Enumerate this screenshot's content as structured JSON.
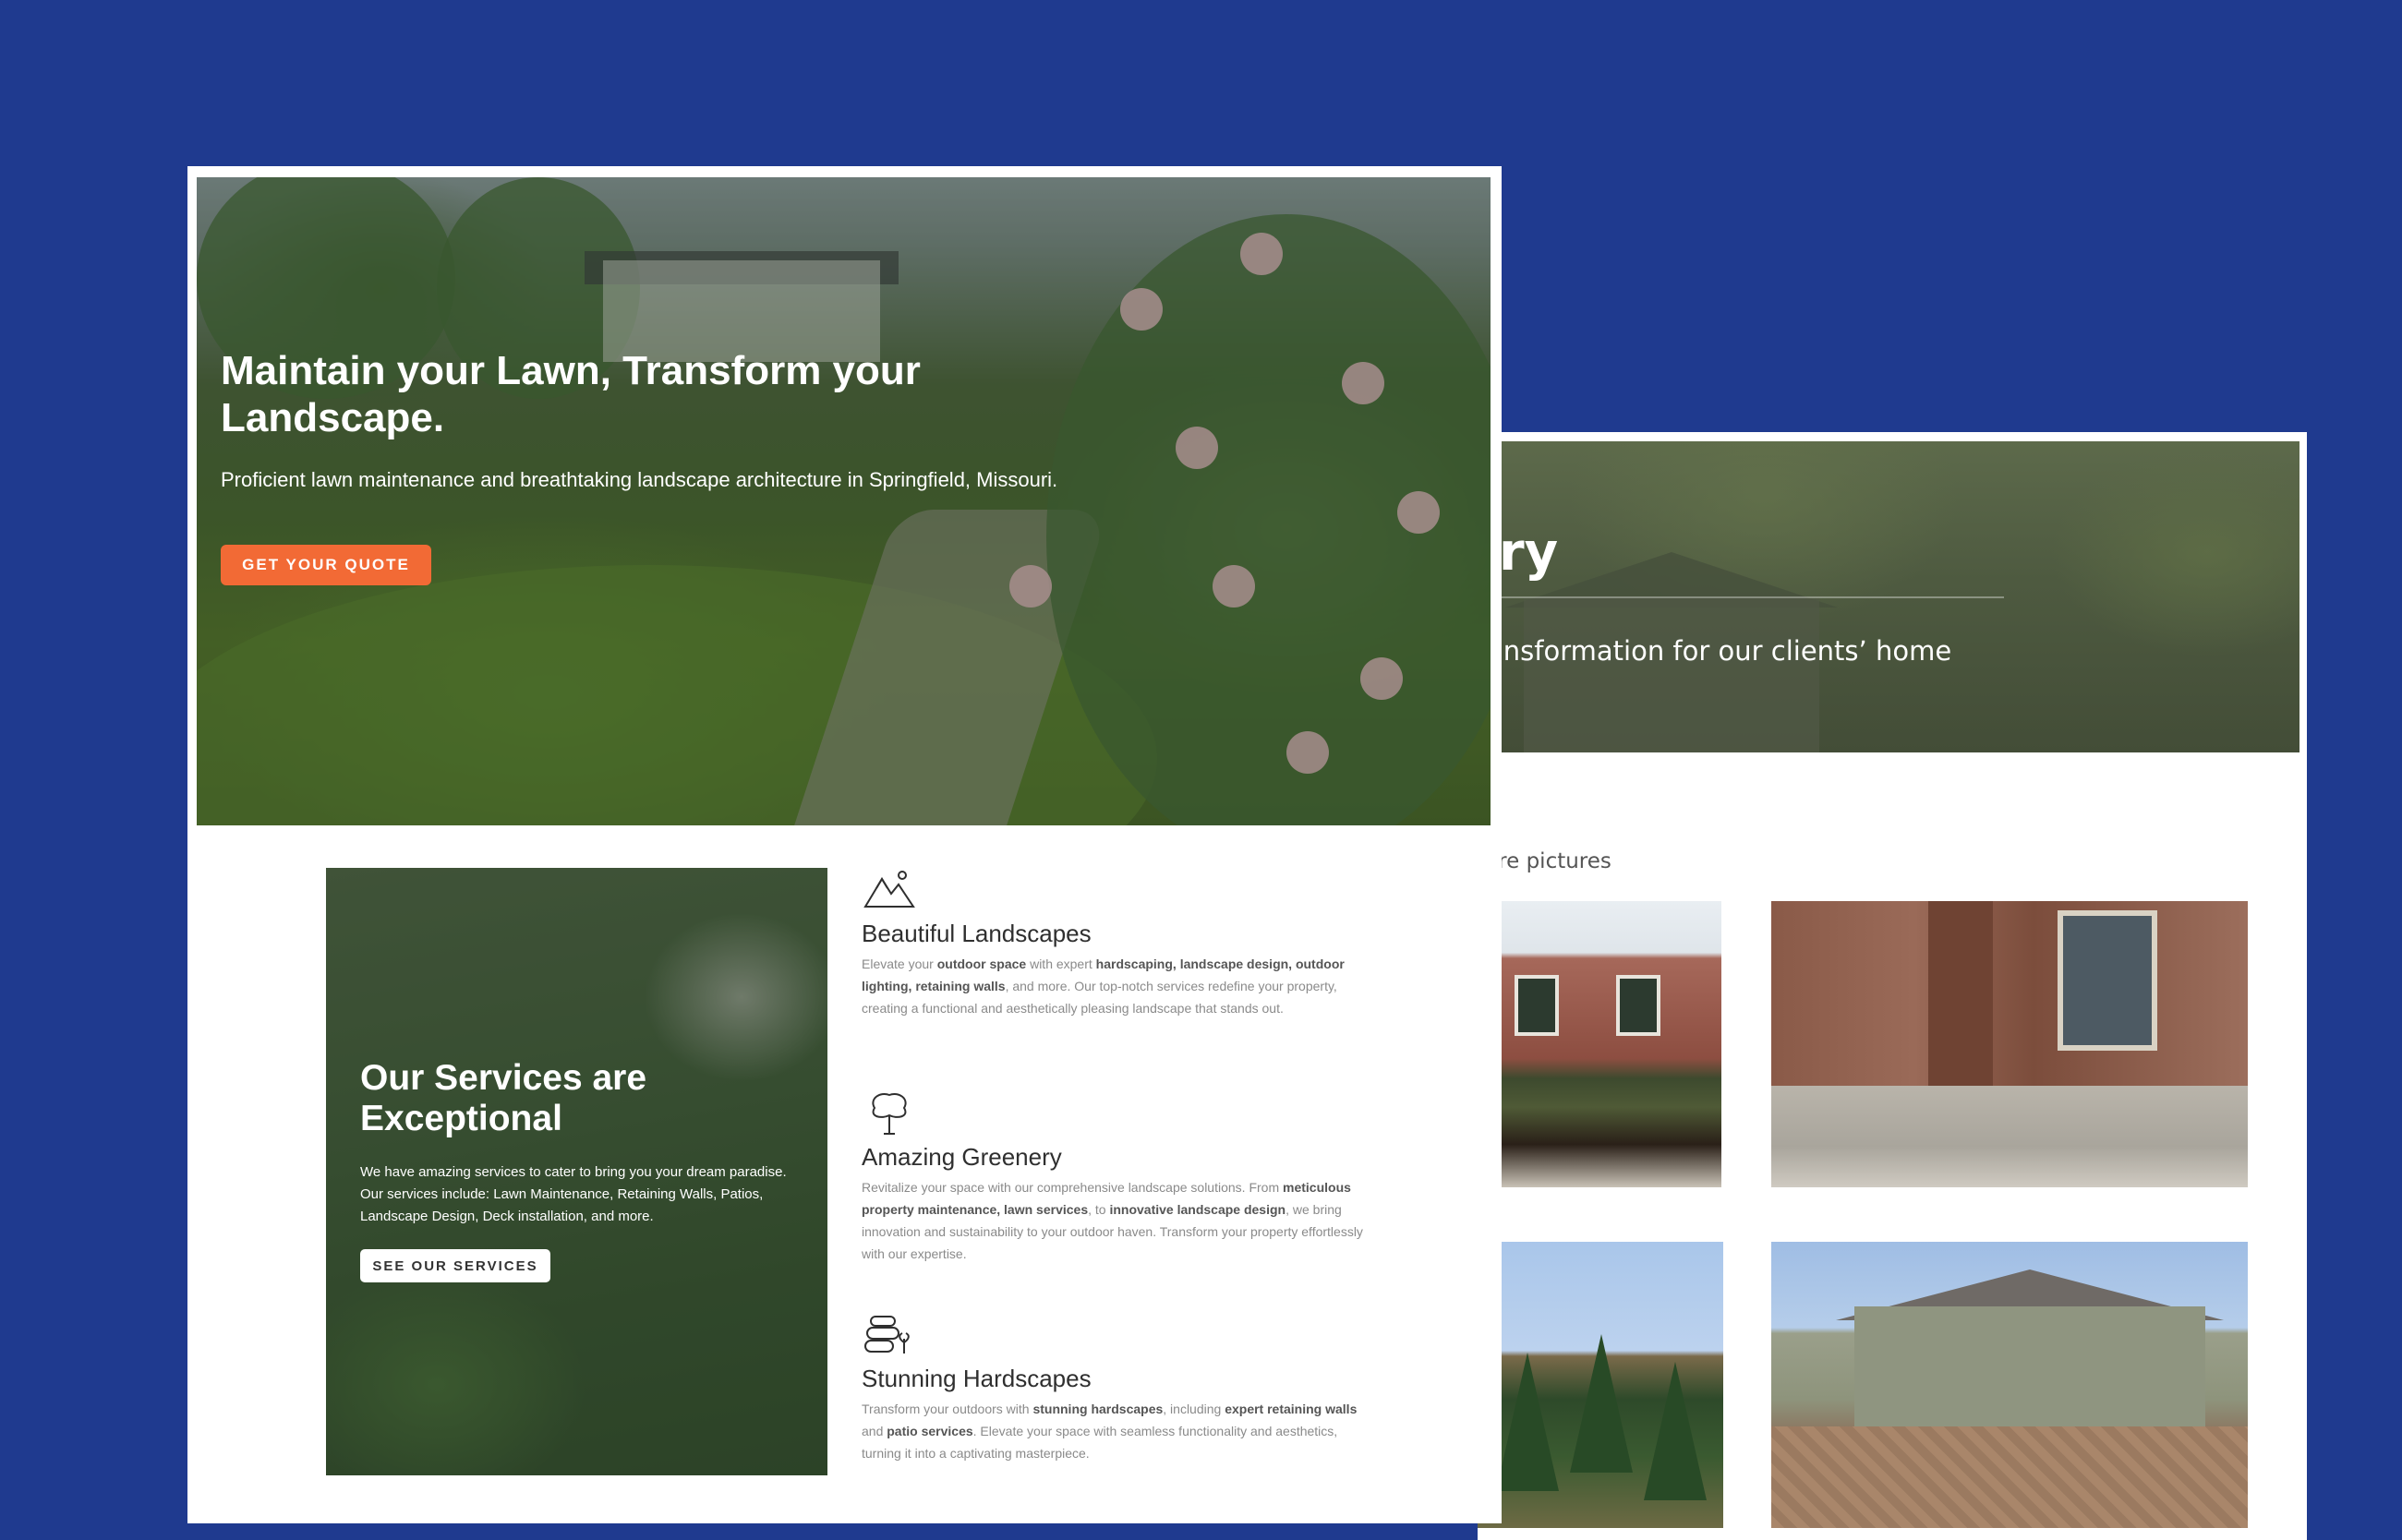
{
  "gallery_page": {
    "hero_title_fragment": "ery",
    "hero_subtitle_fragment": "ansformation for our clients’ home",
    "caption_fragment": "fore pictures",
    "photos": [
      "house-brick-front",
      "house-brick-entry",
      "evergreen-trees",
      "house-paver-patio"
    ]
  },
  "home_page": {
    "hero": {
      "title": "Maintain your Lawn, Transform your Landscape.",
      "subtitle": "Proficient lawn maintenance and breathtaking landscape architecture in Springfield, Missouri.",
      "cta_label": "GET YOUR QUOTE"
    },
    "services": {
      "title": "Our Services are Exceptional",
      "text": "We have amazing services to cater to bring you your dream paradise. Our services include: Lawn Maintenance, Retaining Walls, Patios, Landscape Design, Deck installation, and more.",
      "button_label": "SEE OUR SERVICES"
    },
    "features": [
      {
        "icon": "mountains-icon",
        "title": "Beautiful Landscapes",
        "text_parts": [
          "Elevate your ",
          "outdoor space",
          " with expert ",
          "hardscaping, landscape design, outdoor lighting, retaining walls",
          ", and more. Our top-notch services redefine your property, creating a functional and aesthetically pleasing landscape that stands out."
        ]
      },
      {
        "icon": "tree-icon",
        "title": "Amazing Greenery",
        "text_parts": [
          "Revitalize your space with our comprehensive landscape solutions. From ",
          "meticulous property maintenance, lawn services",
          ", to ",
          "innovative landscape design",
          ", we bring innovation and sustainability to your outdoor haven. Transform your property effortlessly with our expertise."
        ]
      },
      {
        "icon": "stones-plant-icon",
        "title": "Stunning Hardscapes",
        "text_parts": [
          "Transform your outdoors with ",
          "stunning hardscapes",
          ", including ",
          "expert retaining walls",
          " and ",
          "patio services",
          ". Elevate your space with seamless functionality and aesthetics, turning it into a captivating masterpiece."
        ]
      }
    ]
  },
  "colors": {
    "background": "#1f3a8f",
    "cta": "#f26a35",
    "card": "#ffffff"
  }
}
